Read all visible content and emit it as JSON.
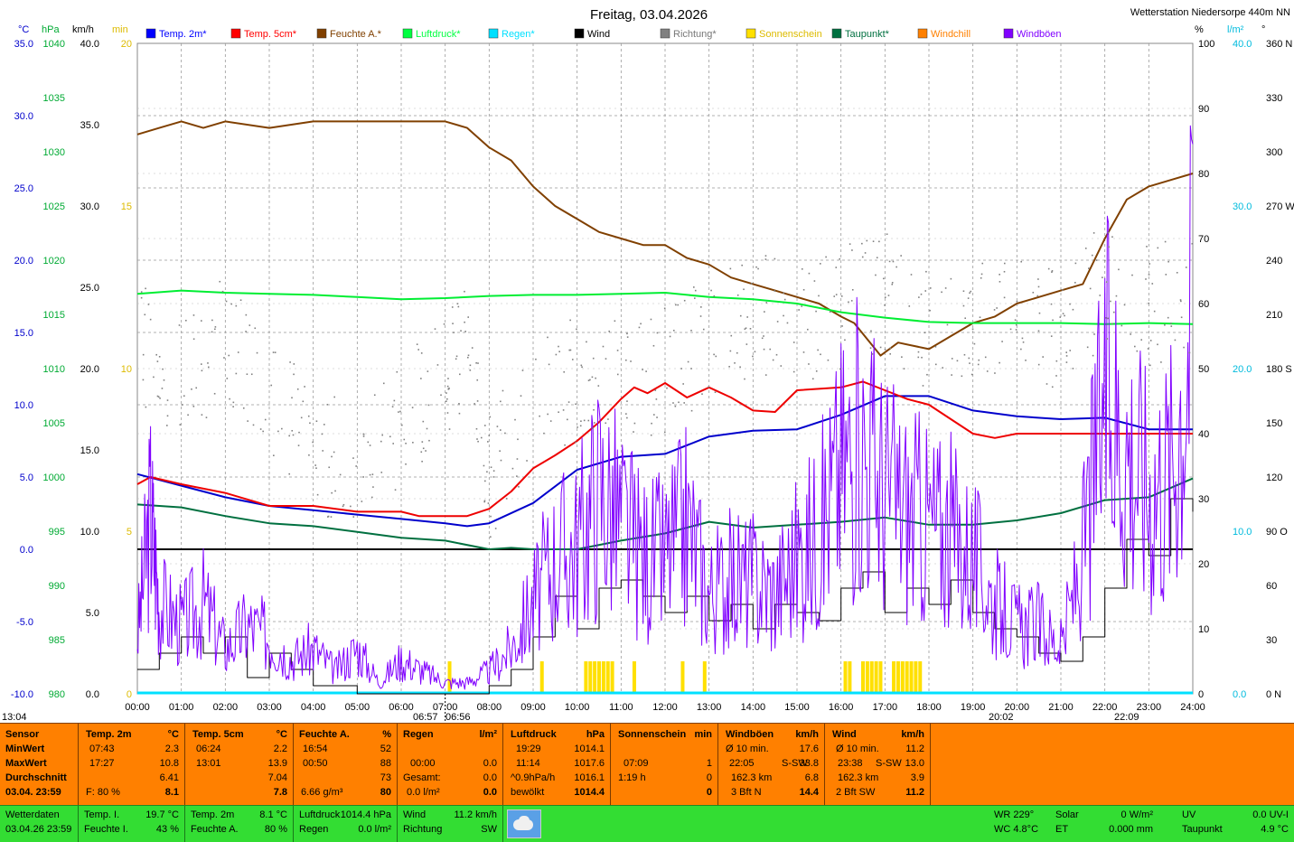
{
  "header": {
    "title": "Freitag, 03.04.2026",
    "station": "Wetterstation Niedersorpe 440m NN"
  },
  "legend": [
    {
      "label": "Temp. 2m*",
      "color": "#0000ff",
      "icon": "square-swatch"
    },
    {
      "label": "Temp. 5cm*",
      "color": "#ff0000",
      "icon": "square-swatch"
    },
    {
      "label": "Feuchte A.*",
      "color": "#804000",
      "icon": "square-swatch"
    },
    {
      "label": "Luftdruck*",
      "color": "#00ff40",
      "icon": "square-swatch"
    },
    {
      "label": "Regen*",
      "color": "#00e0ff",
      "icon": "square-swatch"
    },
    {
      "label": "Wind",
      "color": "#000000",
      "icon": "square-swatch"
    },
    {
      "label": "Richtung*",
      "color": "#808080",
      "icon": "square-swatch"
    },
    {
      "label": "Sonnenschein",
      "color": "#ffe000",
      "icon": "square-swatch"
    },
    {
      "label": "Taupunkt*",
      "color": "#007040",
      "icon": "square-swatch"
    },
    {
      "label": "Windchill",
      "color": "#ff8000",
      "icon": "square-swatch"
    },
    {
      "label": "Windböen",
      "color": "#8000ff",
      "icon": "square-swatch"
    }
  ],
  "axes": {
    "units": {
      "temp": "°C",
      "press": "hPa",
      "wind": "km/h",
      "sun": "min",
      "hum": "%",
      "rain": "l/m²",
      "dir": "°"
    },
    "temp_ticks": [
      "35.0",
      "30.0",
      "25.0",
      "20.0",
      "15.0",
      "10.0",
      "5.0",
      "0.0",
      "-5.0",
      "-10.0"
    ],
    "press_ticks": [
      "1040",
      "1035",
      "1030",
      "1025",
      "1020",
      "1015",
      "1010",
      "1005",
      "1000",
      "995",
      "990",
      "985",
      "980"
    ],
    "wind_ticks": [
      "40.0",
      "35.0",
      "30.0",
      "25.0",
      "20.0",
      "15.0",
      "10.0",
      "5.0",
      "0.0"
    ],
    "sun_ticks": [
      "20",
      "15",
      "10",
      "5",
      "0"
    ],
    "hum_ticks": [
      "100",
      "90",
      "80",
      "70",
      "60",
      "50",
      "40",
      "30",
      "20",
      "10",
      "0"
    ],
    "rain_ticks": [
      "40.0",
      "30.0",
      "20.0",
      "10.0",
      "0.0"
    ],
    "dir_ticks": [
      "360 N",
      "330",
      "300",
      "270 W",
      "240",
      "210",
      "180 S",
      "150",
      "120",
      "90 O",
      "60",
      "30",
      "0 N"
    ],
    "time_ticks": [
      "00:00",
      "01:00",
      "02:00",
      "03:00",
      "04:00",
      "05:00",
      "06:00",
      "07:00",
      "08:00",
      "09:00",
      "10:00",
      "11:00",
      "12:00",
      "13:00",
      "14:00",
      "15:00",
      "16:00",
      "17:00",
      "18:00",
      "19:00",
      "20:00",
      "21:00",
      "22:00",
      "23:00",
      "24:00"
    ],
    "sun_marks": {
      "moonset": "13:04",
      "sunrise": "06:57",
      "sunrise2": "06:56",
      "sunset": "20:02",
      "moonrise": "22:09"
    }
  },
  "chart_data": {
    "type": "line",
    "x_unit": "hour",
    "x_range": [
      0,
      24
    ],
    "series": [
      {
        "name": "Temp. 2m*",
        "axis": "temp",
        "color": "#0000cc",
        "x": [
          0,
          1,
          2,
          3,
          4,
          5,
          6,
          7,
          7.5,
          8,
          9,
          10,
          11,
          12,
          13,
          14,
          15,
          16,
          17,
          18,
          19,
          20,
          21,
          22,
          23,
          24
        ],
        "y": [
          5.2,
          4.4,
          3.6,
          3.0,
          2.7,
          2.4,
          2.1,
          1.8,
          1.6,
          1.8,
          3.2,
          5.5,
          6.4,
          6.6,
          7.8,
          8.2,
          8.3,
          9.3,
          10.6,
          10.6,
          9.6,
          9.2,
          9.0,
          9.1,
          8.3,
          8.3
        ]
      },
      {
        "name": "Temp. 5cm*",
        "axis": "temp",
        "color": "#ee0000",
        "x": [
          0,
          0.3,
          1,
          2,
          3,
          4,
          5,
          6,
          6.4,
          7,
          7.5,
          8,
          8.5,
          9,
          9.5,
          10,
          10.5,
          11,
          11.3,
          11.6,
          12,
          12.5,
          13,
          13.5,
          14,
          14.5,
          15,
          16,
          16.5,
          17,
          17.5,
          18,
          18.5,
          19,
          19.5,
          20,
          21,
          22,
          23,
          24
        ],
        "y": [
          4.5,
          5.0,
          4.5,
          3.9,
          3.0,
          3.0,
          2.6,
          2.6,
          2.3,
          2.3,
          2.3,
          2.8,
          4.0,
          5.6,
          6.5,
          7.5,
          8.8,
          10.4,
          11.2,
          10.8,
          11.5,
          10.5,
          11.2,
          10.5,
          9.6,
          9.5,
          11.0,
          11.2,
          11.6,
          11.0,
          10.4,
          10.0,
          9.0,
          8.0,
          7.7,
          8.0,
          8.0,
          8.0,
          8.0,
          8.0
        ]
      },
      {
        "name": "Feuchte A.*",
        "axis": "hum",
        "color": "#804000",
        "x": [
          0,
          0.5,
          1,
          1.5,
          2,
          3,
          4,
          5,
          6,
          7,
          7.5,
          8,
          8.5,
          9,
          9.5,
          10,
          10.5,
          11,
          11.5,
          12,
          12.5,
          13,
          13.5,
          14,
          14.5,
          15,
          15.5,
          16,
          16.3,
          16.9,
          17.3,
          18,
          18.5,
          19,
          19.5,
          20,
          20.5,
          21,
          21.5,
          22,
          22.5,
          23,
          23.5,
          24
        ],
        "y": [
          86,
          87,
          88,
          87,
          88,
          87,
          88,
          88,
          88,
          88,
          87,
          84,
          82,
          78,
          75,
          73,
          71,
          70,
          69,
          69,
          67,
          66,
          64,
          63,
          62,
          61,
          60,
          58,
          57,
          52,
          54,
          53,
          55,
          57,
          58,
          60,
          61,
          62,
          63,
          70,
          76,
          78,
          79,
          80
        ]
      },
      {
        "name": "Luftdruck*",
        "axis": "press",
        "color": "#00ee33",
        "x": [
          0,
          1,
          2,
          3,
          4,
          5,
          6,
          7,
          8,
          9,
          10,
          11,
          12,
          13,
          14,
          15,
          16,
          17,
          18,
          19,
          20,
          21,
          22,
          23,
          24
        ],
        "y": [
          1016.9,
          1017.2,
          1017.0,
          1016.9,
          1016.8,
          1016.6,
          1016.4,
          1016.5,
          1016.7,
          1016.8,
          1016.8,
          1016.9,
          1017.0,
          1016.6,
          1016.4,
          1016.0,
          1015.2,
          1014.7,
          1014.3,
          1014.2,
          1014.2,
          1014.2,
          1014.1,
          1014.2,
          1014.1
        ]
      },
      {
        "name": "Taupunkt*",
        "axis": "temp",
        "color": "#007040",
        "x": [
          0,
          1,
          2,
          3,
          4,
          5,
          6,
          7,
          8,
          8.5,
          9,
          10,
          11,
          12,
          13,
          14,
          15,
          16,
          17,
          18,
          19,
          20,
          21,
          22,
          23,
          24
        ],
        "y": [
          3.1,
          2.9,
          2.3,
          1.8,
          1.6,
          1.2,
          0.8,
          0.6,
          0.0,
          0.1,
          0.0,
          0.0,
          0.6,
          1.1,
          1.9,
          1.5,
          1.7,
          1.9,
          2.2,
          1.7,
          1.7,
          2.0,
          2.5,
          3.4,
          3.6,
          4.9
        ]
      },
      {
        "name": "Wind",
        "axis": "wind",
        "color": "#000000",
        "x": [
          0,
          0.5,
          1,
          1.5,
          2,
          2.5,
          3,
          3.5,
          4,
          5,
          6,
          7,
          8,
          8.5,
          9,
          9.5,
          10,
          10.5,
          11,
          11.5,
          12,
          12.5,
          13,
          13.5,
          14,
          14.5,
          15,
          15.5,
          16,
          16.5,
          17,
          17.5,
          18,
          18.5,
          19,
          19.5,
          20,
          20.5,
          21,
          21.5,
          22,
          22.5,
          23,
          23.5,
          24
        ],
        "y": [
          1.5,
          2.5,
          3.5,
          2.5,
          3.5,
          1.0,
          2.5,
          1.5,
          0.5,
          0.0,
          0.0,
          0.0,
          0.5,
          1.5,
          3.5,
          6.0,
          4.0,
          6.5,
          7.0,
          6.0,
          5.0,
          6.0,
          4.5,
          5.5,
          4.0,
          5.5,
          5.0,
          4.5,
          6.5,
          7.5,
          5.0,
          6.5,
          5.5,
          7.0,
          5.0,
          4.0,
          3.5,
          2.5,
          2.0,
          3.5,
          6.5,
          9.5,
          8.5,
          12.0,
          11.2
        ]
      },
      {
        "name": "Windböen",
        "axis": "wind",
        "color": "#8000ff",
        "x": [
          0,
          0.3,
          0.5,
          1,
          1.5,
          2,
          2.5,
          3,
          3.5,
          4,
          4.5,
          5,
          5.5,
          6,
          6.5,
          7,
          7.5,
          8,
          8.5,
          9,
          9.5,
          10,
          10.5,
          11,
          11.5,
          12,
          12.5,
          13,
          13.5,
          14,
          14.5,
          15,
          15.5,
          16,
          16.5,
          17,
          17.5,
          18,
          18.5,
          19,
          19.5,
          20,
          20.5,
          21,
          21.5,
          22,
          22.5,
          23,
          23.5,
          24
        ],
        "y": [
          5,
          16,
          8,
          6,
          8,
          4,
          6,
          5,
          3,
          4,
          2,
          4,
          1,
          3,
          2,
          1,
          1,
          2,
          4,
          8,
          12,
          13,
          18,
          15,
          12,
          12,
          15,
          9,
          10,
          10,
          9,
          12,
          14,
          20,
          22,
          18,
          16,
          15,
          14,
          12,
          8,
          6,
          6,
          4,
          12,
          26,
          22,
          18,
          20,
          33.8
        ]
      },
      {
        "name": "Richtung*",
        "axis": "dir",
        "color": "#808080",
        "style": "dots",
        "x": [
          0,
          1,
          2,
          3,
          4,
          5,
          6,
          7,
          7.5,
          8,
          9,
          10,
          11,
          12,
          13,
          14,
          15,
          16,
          17,
          18,
          19,
          20,
          21,
          22,
          23,
          24
        ],
        "y": [
          195,
          170,
          200,
          165,
          135,
          125,
          150,
          180,
          190,
          120,
          165,
          175,
          175,
          180,
          200,
          210,
          205,
          215,
          225,
          200,
          205,
          220,
          200,
          230,
          215,
          225
        ]
      }
    ],
    "sunshine_x": [
      7.1,
      9.2,
      10.2,
      10.3,
      10.4,
      10.5,
      10.6,
      10.7,
      10.8,
      11.3,
      12.4,
      12.9,
      16.1,
      16.2,
      16.5,
      16.6,
      16.7,
      16.8,
      16.9,
      17.2,
      17.3,
      17.4,
      17.5,
      17.6,
      17.7,
      17.8
    ],
    "constant_lines": [
      {
        "axis": "temp",
        "y": 0,
        "color": "#000000"
      }
    ]
  },
  "summary": {
    "sensor": {
      "title": "Sensor",
      "rows": [
        "MinWert",
        "MaxWert",
        "Durchschnitt",
        "03.04. 23:59"
      ]
    },
    "temp2": {
      "title": "Temp. 2m",
      "unit": "°C",
      "min_t": "07:43",
      "min_v": "2.3",
      "max_t": "17:27",
      "max_v": "10.8",
      "avg": "6.41",
      "now_label": "F: 80 %",
      "now": "8.1"
    },
    "temp5": {
      "title": "Temp. 5cm",
      "unit": "°C",
      "min_t": "06:24",
      "min_v": "2.2",
      "max_t": "13:01",
      "max_v": "13.9",
      "avg": "7.04",
      "now": "7.8"
    },
    "hum": {
      "title": "Feuchte A.",
      "unit": "%",
      "min_t": "16:54",
      "min_v": "52",
      "max_t": "00:50",
      "max_v": "88",
      "avg": "73",
      "now_label": "6.66 g/m³",
      "now": "80"
    },
    "rain": {
      "title": "Regen",
      "unit": "l/m²",
      "r1_t": "00:00",
      "r1_v": "0.0",
      "r2_t": "Gesamt:",
      "r2_v": "0.0",
      "now_label": "0.0 l/m²",
      "now": "0.0",
      "blank_v": "0.0"
    },
    "press": {
      "title": "Luftdruck",
      "unit": "hPa",
      "min_t": "19:29",
      "min_v": "1014.1",
      "max_t": "11:14",
      "max_v": "1017.6",
      "avg_t": "^0.9hPa/h",
      "avg": "1016.1",
      "now_label": "bewölkt",
      "now": "1014.4"
    },
    "sun": {
      "title": "Sonnenschein",
      "unit": "min",
      "r1_t": "07:09",
      "r1_v": "1",
      "r2_t": "1:19 h",
      "r2_v": "0",
      "now": "0"
    },
    "gust": {
      "title": "Windböen",
      "unit": "km/h",
      "r1_t": "Ø 10 min.",
      "r1_v": "17.6",
      "r2_t": "22:05",
      "r2_m": "S-SW",
      "r2_v": "33.8",
      "r3_t": "162.3 km",
      "r3_v": "6.8",
      "now_label": "3 Bft N",
      "now": "14.4"
    },
    "wind": {
      "title": "Wind",
      "unit": "km/h",
      "r1_t": "Ø 10 min.",
      "r1_v": "11.2",
      "r2_t": "23:38",
      "r2_m": "S-SW",
      "r2_v": "13.0",
      "r3_t": "162.3 km",
      "r3_v": "3.9",
      "now_label": "2 Bft SW",
      "now": "11.2"
    }
  },
  "current": {
    "title": "Wetterdaten",
    "stamp": "03.04.26 23:59",
    "temp_i_l": "Temp. I.",
    "temp_i": "19.7 °C",
    "hum_i_l": "Feuchte I.",
    "hum_i": "43 %",
    "temp2_l": "Temp. 2m",
    "temp2": "8.1 °C",
    "hum_a_l": "Feuchte A.",
    "hum_a": "80 %",
    "press_l": "Luftdruck",
    "press": "1014.4 hPa",
    "rain_l": "Regen",
    "rain": "0.0 l/m²",
    "wind_l": "Wind",
    "wind": "11.2 km/h",
    "dir_l": "Richtung",
    "dir": "SW",
    "wr": "WR 229°",
    "wc": "WC 4.8°C",
    "solar_l": "Solar",
    "solar": "0 W/m²",
    "et_l": "ET",
    "et": "0.000 mm",
    "uv_l": "UV",
    "uv": "0.0 UV-I",
    "dew_l": "Taupunkt",
    "dew": "4.9 °C",
    "weather_icon": "cloudy-icon"
  }
}
